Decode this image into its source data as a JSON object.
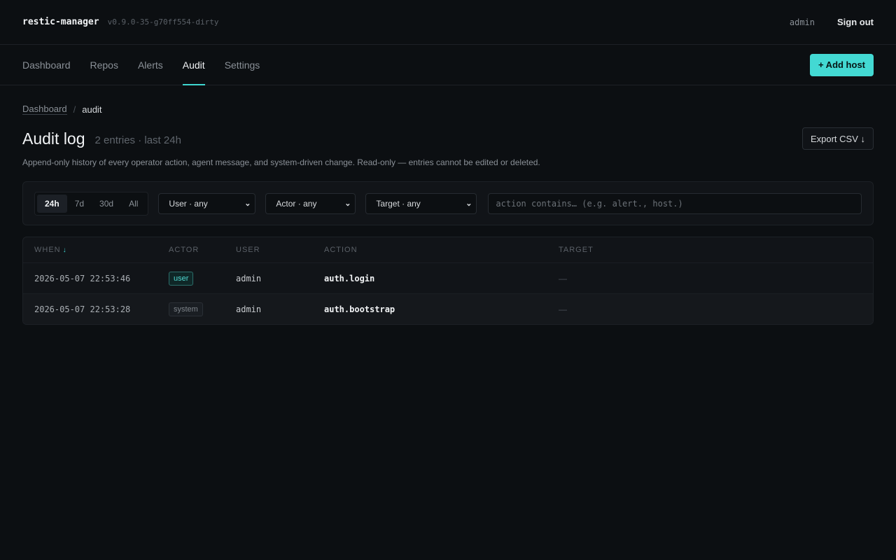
{
  "app": {
    "name": "restic-manager",
    "version": "v0.9.0-35-g70ff554-dirty"
  },
  "header": {
    "user": "admin",
    "sign_out": "Sign out"
  },
  "nav": {
    "tabs": [
      {
        "label": "Dashboard",
        "active": false
      },
      {
        "label": "Repos",
        "active": false
      },
      {
        "label": "Alerts",
        "active": false
      },
      {
        "label": "Audit",
        "active": true
      },
      {
        "label": "Settings",
        "active": false
      }
    ],
    "add_host": "+ Add host"
  },
  "breadcrumb": {
    "parent": "Dashboard",
    "separator": "/",
    "current": "audit"
  },
  "page": {
    "title": "Audit log",
    "meta": "2 entries · last 24h",
    "export_label": "Export CSV ↓",
    "description": "Append-only history of every operator action, agent message, and system-driven change. Read-only — entries cannot be edited or deleted."
  },
  "filters": {
    "ranges": [
      {
        "label": "24h",
        "active": true
      },
      {
        "label": "7d",
        "active": false
      },
      {
        "label": "30d",
        "active": false
      },
      {
        "label": "All",
        "active": false
      }
    ],
    "user_select": "User · any",
    "actor_select": "Actor · any",
    "target_select": "Target · any",
    "search_placeholder": "action contains… (e.g. alert., host.)",
    "search_value": ""
  },
  "table": {
    "columns": {
      "when": "WHEN",
      "actor": "ACTOR",
      "user": "USER",
      "action": "ACTION",
      "target": "TARGET"
    },
    "sort_indicator": "↓",
    "rows": [
      {
        "when": "2026-05-07 22:53:46",
        "actor": "user",
        "user": "admin",
        "action": "auth.login",
        "target": "—"
      },
      {
        "when": "2026-05-07 22:53:28",
        "actor": "system",
        "user": "admin",
        "action": "auth.bootstrap",
        "target": "—"
      }
    ]
  },
  "colors": {
    "accent": "#43d9d3",
    "background": "#0c0f12",
    "panel": "#111418"
  }
}
